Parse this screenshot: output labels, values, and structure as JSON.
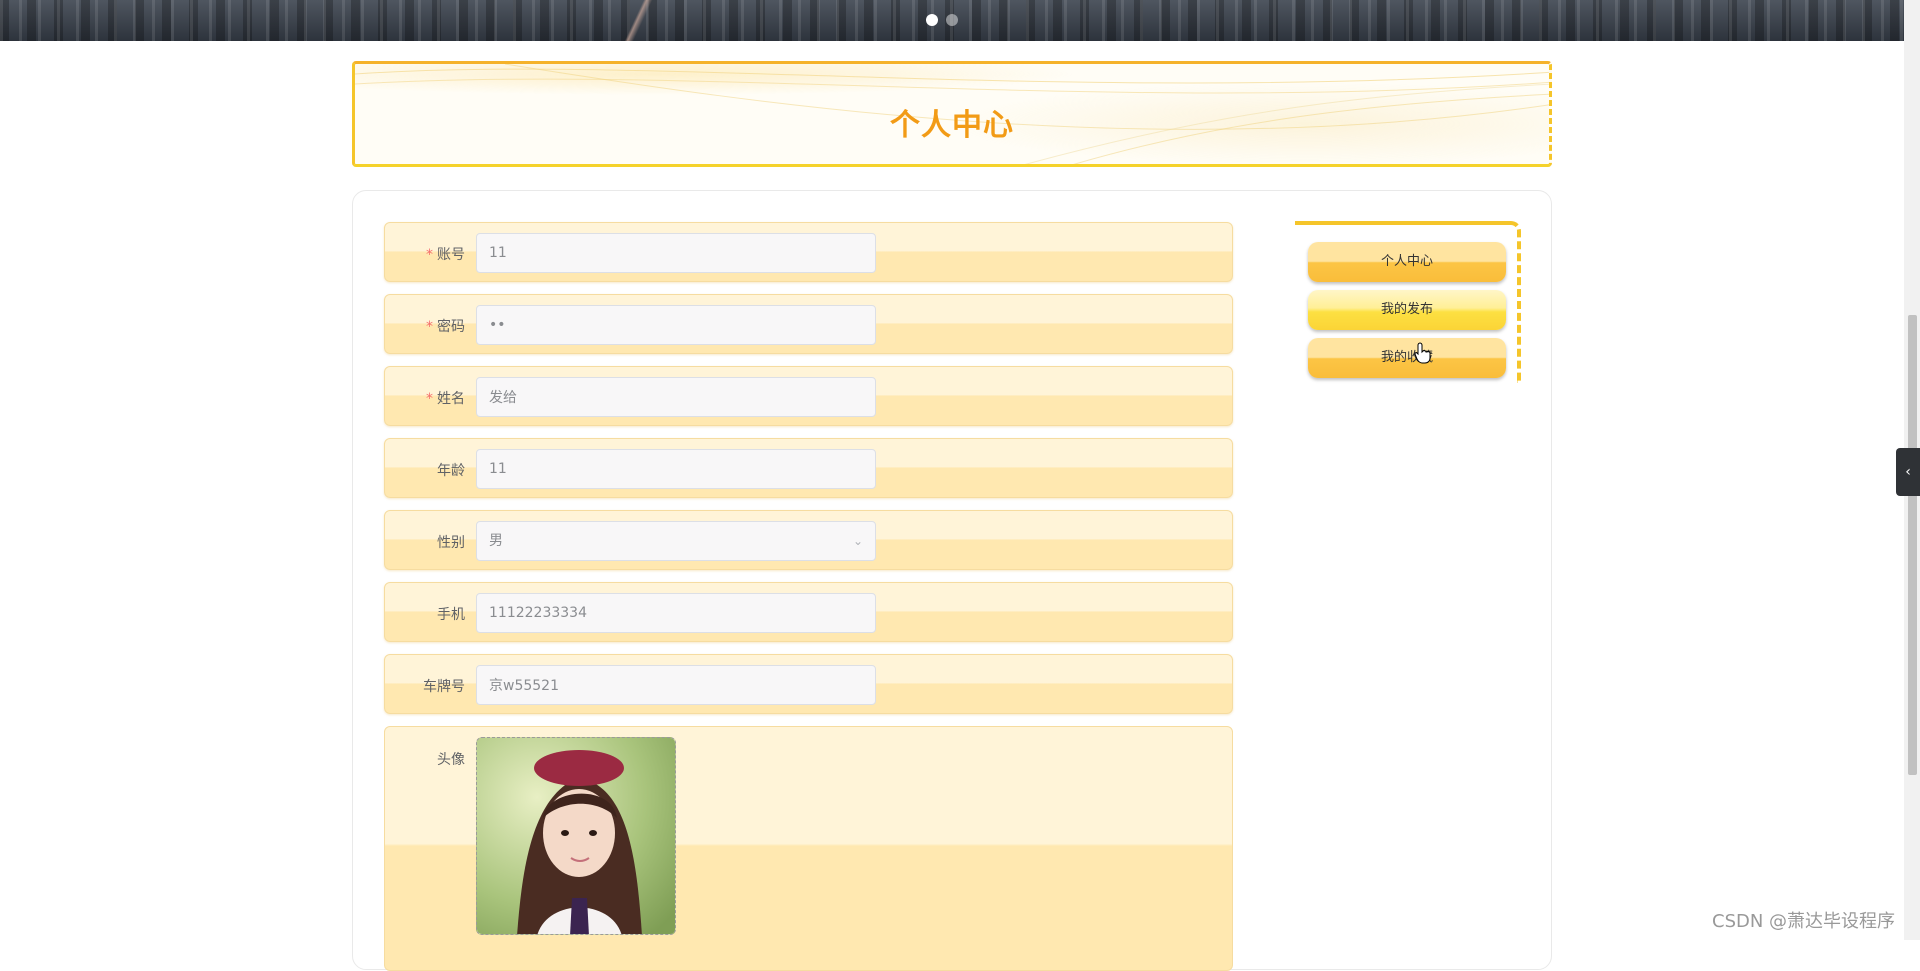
{
  "banner": {
    "carousel_dots": [
      "slide-1",
      "slide-2"
    ],
    "active_index": 0
  },
  "page": {
    "title": "个人中心"
  },
  "form": {
    "fields": [
      {
        "label": "账号",
        "required": true,
        "value": "11"
      },
      {
        "label": "密码",
        "required": true,
        "value": "••"
      },
      {
        "label": "姓名",
        "required": true,
        "value": "发给"
      },
      {
        "label": "年龄",
        "required": false,
        "value": "11"
      },
      {
        "label": "性别",
        "required": false,
        "value": "男"
      },
      {
        "label": "手机",
        "required": false,
        "value": "11122233334"
      },
      {
        "label": "车牌号",
        "required": false,
        "value": "京w55521"
      }
    ],
    "avatar_label": "头像"
  },
  "side_menu": {
    "items": [
      "个人中心",
      "我的发布",
      "我的收藏"
    ]
  },
  "watermark": "CSDN @萧达毕设程序",
  "colors": {
    "accent": "#f29b16",
    "border_yellow": "#f5c52a",
    "required": "#f56c6c"
  },
  "icons": {
    "select_caret": "chevron-down-icon",
    "side_toggle": "chevron-left-icon"
  }
}
